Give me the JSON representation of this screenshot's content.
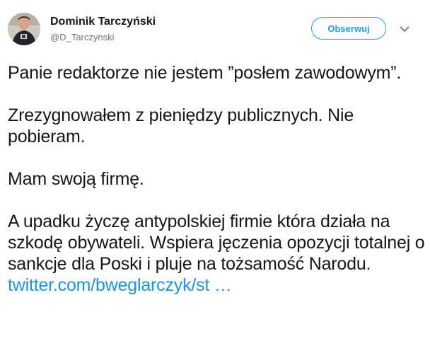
{
  "user": {
    "display_name": "Dominik Tarczyński",
    "handle": "@D_Tarczynski"
  },
  "actions": {
    "follow_label": "Obserwuj",
    "more_icon": "chevron-down-icon"
  },
  "tweet": {
    "paragraph_1": "Panie redaktorze nie jestem ”posłem zawodowym”.",
    "paragraph_2": "Zrezygnowałem z pieniędzy publicznych. Nie pobieram.",
    "paragraph_3": "Mam swoją firmę.",
    "paragraph_4_text": "A upadku życzę antypolskiej firmie która działa na szkodę obywateli. Wspiera jęczenia opozycji totalnej o sankcje dla Poski i pluje na tożsamość Narodu.",
    "link_text": "twitter.com/bweglarczyk/st …"
  },
  "colors": {
    "accent": "#1da1f2",
    "link": "#1b95e0",
    "text": "#14171a",
    "secondary_text": "#657786"
  }
}
